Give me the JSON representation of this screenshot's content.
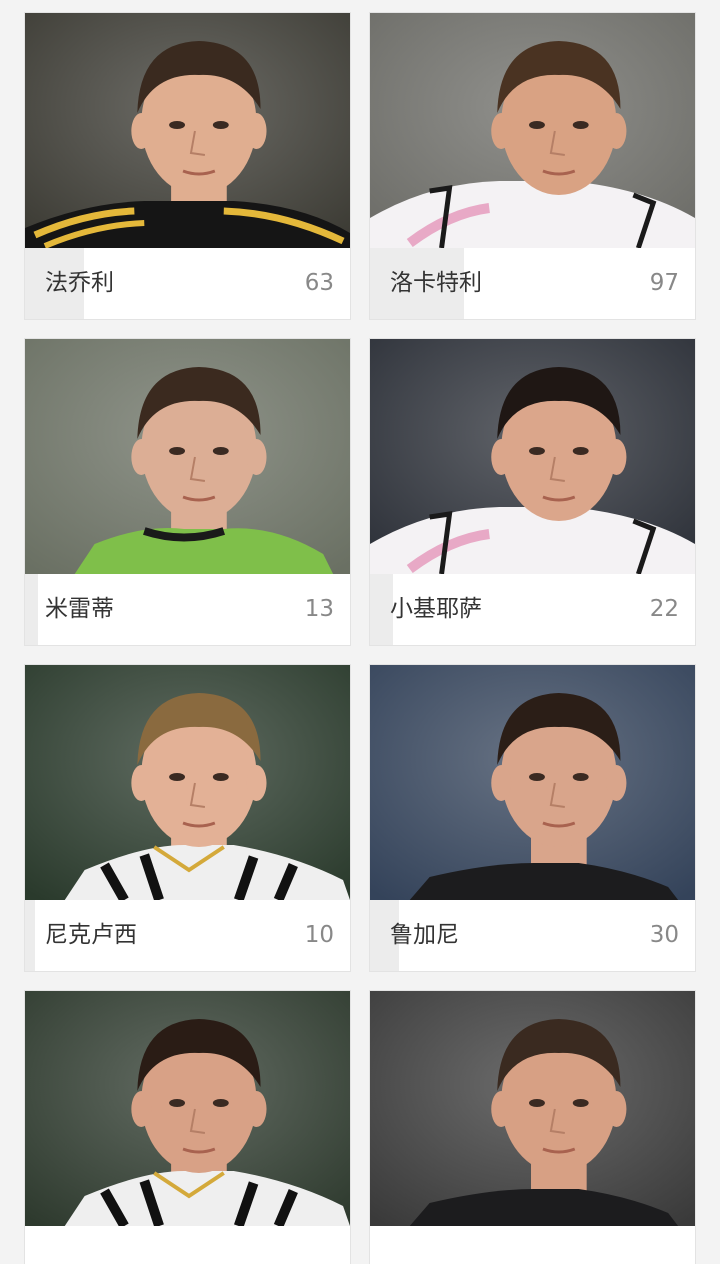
{
  "players": [
    {
      "name": "法乔利",
      "votes": "63",
      "vote_share": 0.18,
      "jersey": "yellow-black",
      "bg": "#3b3a33",
      "hair": "#3a2a1f",
      "skin": "#e0ae90"
    },
    {
      "name": "洛卡特利",
      "votes": "97",
      "vote_share": 0.29,
      "jersey": "white-pink",
      "bg": "#6b6b66",
      "hair": "#4a3322",
      "skin": "#d9a283"
    },
    {
      "name": "米雷蒂",
      "votes": "13",
      "vote_share": 0.04,
      "jersey": "green",
      "bg": "#6a7063",
      "hair": "#3b2a1f",
      "skin": "#dcae95"
    },
    {
      "name": "小基耶萨",
      "votes": "22",
      "vote_share": 0.07,
      "jersey": "white-pink",
      "bg": "#2b2f37",
      "hair": "#1f1714",
      "skin": "#dba68b"
    },
    {
      "name": "尼克卢西",
      "votes": "10",
      "vote_share": 0.03,
      "jersey": "black-white",
      "bg": "#2a3a2c",
      "hair": "#8a6a3f",
      "skin": "#e3b196"
    },
    {
      "name": "鲁加尼",
      "votes": "30",
      "vote_share": 0.09,
      "jersey": "dark",
      "bg": "#34435a",
      "hair": "#2b1e17",
      "skin": "#d9a58b"
    },
    {
      "name": "",
      "votes": "",
      "vote_share": 0,
      "jersey": "black-white",
      "bg": "#2e3a2e",
      "hair": "#2a1c15",
      "skin": "#d8a186"
    },
    {
      "name": "",
      "votes": "",
      "vote_share": 0,
      "jersey": "dark",
      "bg": "#3a3a3a",
      "hair": "#3a2a20",
      "skin": "#d7a084"
    }
  ]
}
